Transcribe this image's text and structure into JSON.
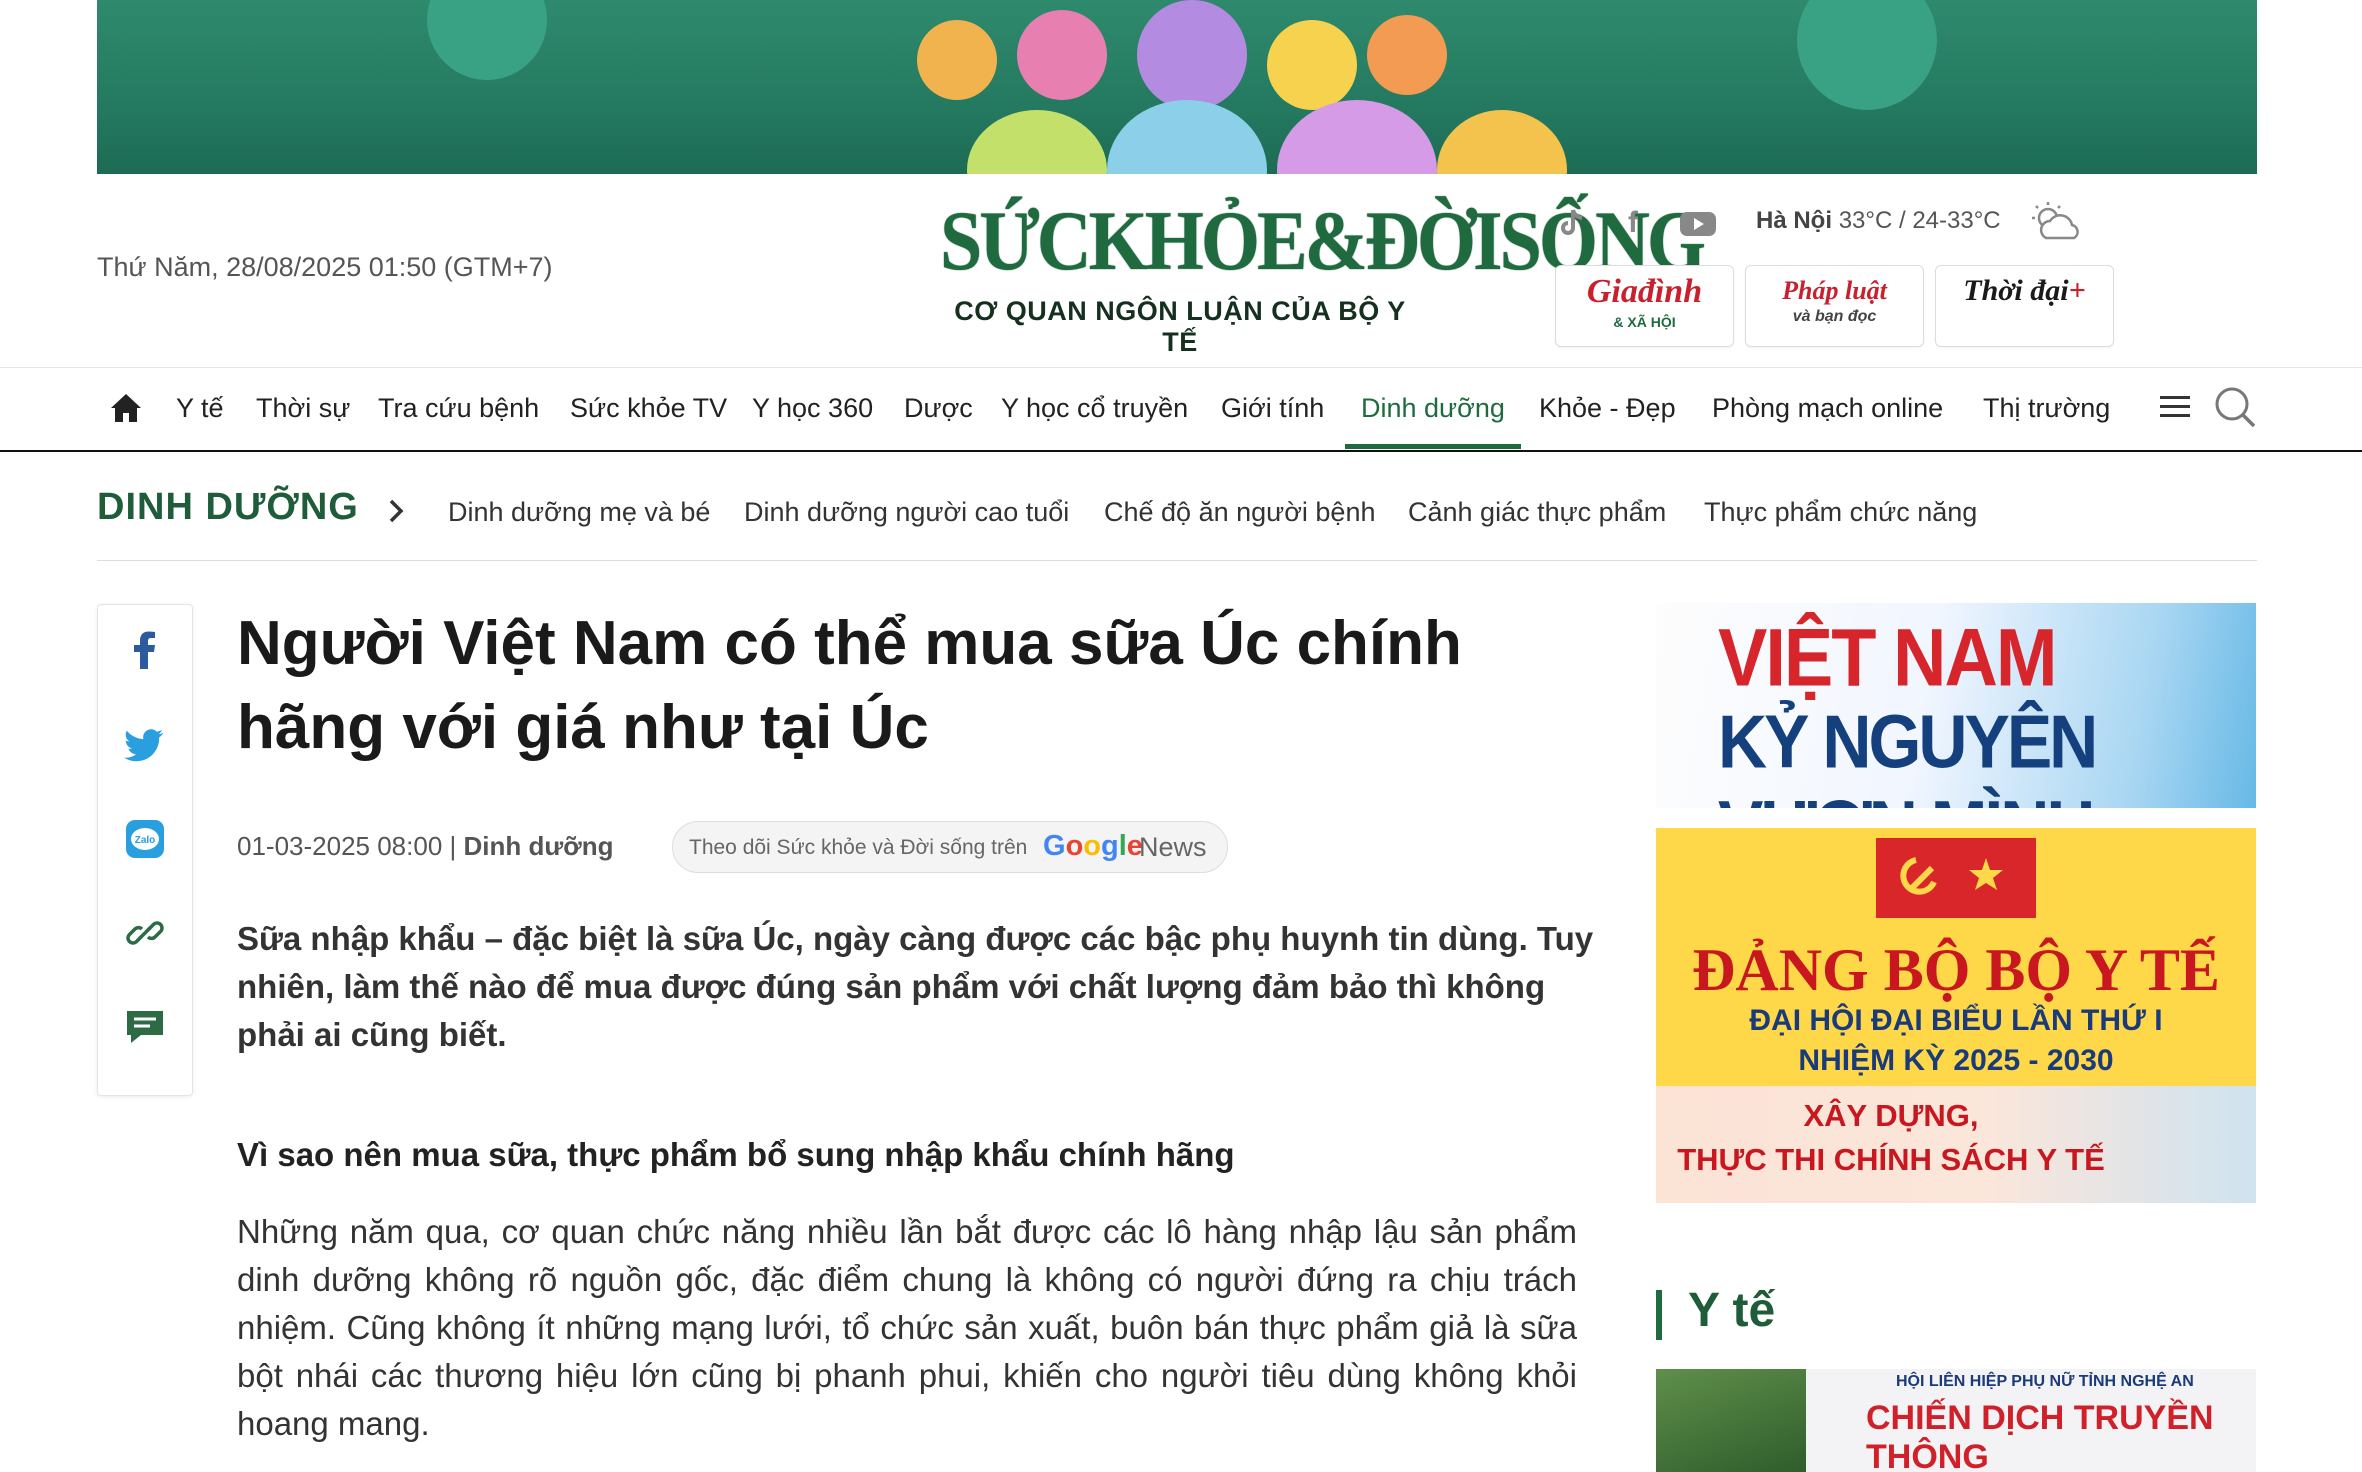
{
  "header": {
    "datetime": "Thứ Năm, 28/08/2025 01:50 (GTM+7)",
    "logo_main": "SỨCKHỎE&ĐỜISỐNG",
    "logo_sub": "CƠ QUAN NGÔN LUẬN CỦA BỘ Y TẾ",
    "weather_city": "Hà Nội",
    "weather_temp": "33°C / 24-33°C",
    "social_icons": [
      "tiktok-icon",
      "facebook-icon",
      "youtube-icon"
    ],
    "partners": [
      {
        "title": "Giađình",
        "sub": "& XÃ HỘI"
      },
      {
        "title": "Pháp luật",
        "sub": "và bạn đọc"
      },
      {
        "title": "Thời đại",
        "sub": "+"
      }
    ]
  },
  "nav": {
    "items": [
      "Y tế",
      "Thời sự",
      "Tra cứu bệnh",
      "Sức khỏe TV",
      "Y học 360",
      "Dược",
      "Y học cổ truyền",
      "Giới tính",
      "Dinh dưỡng",
      "Khỏe - Đẹp",
      "Phòng mạch online",
      "Thị trường"
    ],
    "active_index": 8
  },
  "subnav": {
    "title": "DINH DƯỠNG",
    "items": [
      "Dinh dưỡng mẹ và bé",
      "Dinh dưỡng người cao tuổi",
      "Chế độ ăn người bệnh",
      "Cảnh giác thực phẩm",
      "Thực phẩm chức năng"
    ]
  },
  "article": {
    "title": "Người Việt Nam có thể mua sữa Úc chính hãng với giá như tại Úc",
    "date": "01-03-2025 08:00",
    "separator": "|",
    "category": "Dinh dưỡng",
    "gnews_text": "Theo dõi Sức khỏe và Đời sống trên",
    "gnews_brand": "Google",
    "gnews_news": "News",
    "sapo": "Sữa nhập khẩu – đặc biệt là sữa Úc, ngày càng được các bậc phụ huynh tin dùng. Tuy nhiên, làm thế nào để mua được đúng sản phẩm với chất lượng đảm bảo thì không phải ai cũng biết.",
    "h2": "Vì sao nên mua sữa, thực phẩm bổ sung nhập khẩu chính hãng",
    "body": "Những năm qua, cơ quan chức năng nhiều lần bắt được các lô hàng nhập lậu sản phẩm dinh dưỡng không rõ nguồn gốc, đặc điểm chung là không có người đứng ra chịu trách nhiệm. Cũng không ít những mạng lưới, tổ chức sản xuất, buôn bán thực phẩm giả là sữa bột nhái các thương hiệu lớn cũng bị phanh phui, khiến cho người tiêu dùng không khỏi hoang mang."
  },
  "share_icons": [
    "facebook-icon",
    "twitter-icon",
    "zalo-icon",
    "link-icon",
    "comment-icon"
  ],
  "sidebar": {
    "ad1_line1": "VIỆT NAM",
    "ad1_line2": "KỶ NGUYÊN VƯƠN MÌNH",
    "ad2_title": "ĐẢNG BỘ BỘ Y TẾ",
    "ad2_line1": "ĐẠI HỘI ĐẠI BIỂU LẦN THỨ I",
    "ad2_line2": "NHIỆM KỲ 2025 - 2030",
    "ad2_bottom1": "XÂY DỰNG,",
    "ad2_bottom2": "THỰC THI CHÍNH SÁCH Y TẾ",
    "section_title": "Y tế",
    "ad3_line1": "HỘI LIÊN HIỆP PHỤ NỮ TỈNH NGHỆ AN",
    "ad3_line2": "CHIẾN DỊCH TRUYỀN THÔNG"
  },
  "colors": {
    "brand_green": "#1f6b3f",
    "accent_red": "#c8202c"
  }
}
